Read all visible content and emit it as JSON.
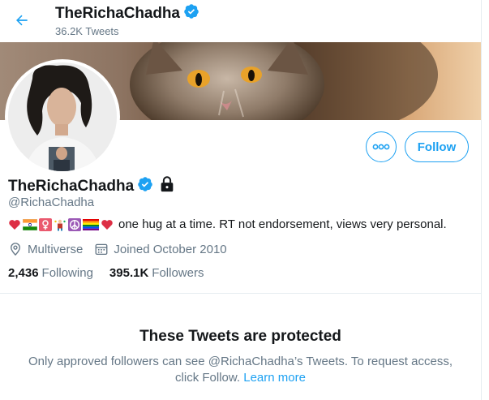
{
  "header": {
    "name": "TheRichaChadha",
    "tweet_count": "36.2K Tweets"
  },
  "profile": {
    "name": "TheRichaChadha",
    "handle": "@RichaChadha",
    "bio_text": "one hug at a time. RT not endorsement, views very personal.",
    "bio_emojis": [
      "red-heart",
      "india-flag",
      "female-sign",
      "juggler",
      "peace-symbol",
      "rainbow-flag",
      "red-heart"
    ],
    "location": "Multiverse",
    "joined": "Joined October 2010",
    "following_count": "2,436",
    "following_label": "Following",
    "followers_count": "395.1K",
    "followers_label": "Followers"
  },
  "actions": {
    "more_label": "More",
    "follow_label": "Follow"
  },
  "protected": {
    "title": "These Tweets are protected",
    "body": "Only approved followers can see @RichaChadha’s Tweets. To request access, click Follow.",
    "learn_more": "Learn more"
  },
  "colors": {
    "accent": "#1da1f2",
    "secondary_text": "#657786",
    "primary_text": "#14171a"
  }
}
